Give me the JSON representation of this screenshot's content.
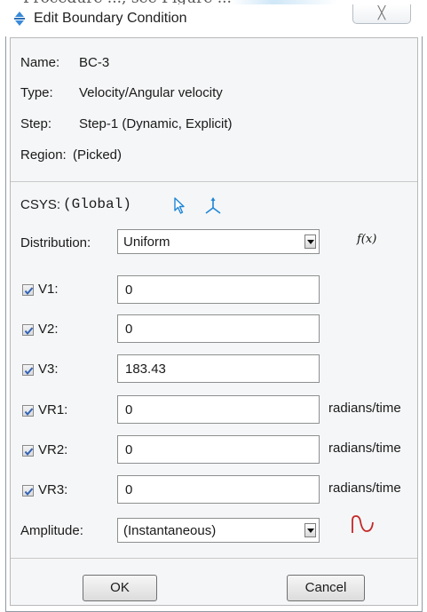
{
  "top_fragment": "Procedure ..., see Figure ...",
  "window": {
    "title": "Edit Boundary Condition",
    "close_glyph": "╳"
  },
  "info": {
    "name_label": "Name:",
    "name_value": "BC-3",
    "type_label": "Type:",
    "type_value": "Velocity/Angular velocity",
    "step_label": "Step:",
    "step_value": "Step-1 (Dynamic, Explicit)",
    "region_label": "Region:",
    "region_value": "(Picked)"
  },
  "csys": {
    "label": "CSYS:",
    "value": "(Global)",
    "icons": [
      "select-arrow-icon",
      "axis-triad-icon"
    ]
  },
  "distribution": {
    "label": "Distribution:",
    "selected": "Uniform",
    "fx_label": "f(x)"
  },
  "components": [
    {
      "label": "V1:",
      "checked": true,
      "value": "0",
      "unit": ""
    },
    {
      "label": "V2:",
      "checked": true,
      "value": "0",
      "unit": ""
    },
    {
      "label": "V3:",
      "checked": true,
      "value": "183.43",
      "unit": ""
    },
    {
      "label": "VR1:",
      "checked": true,
      "value": "0",
      "unit": "radians/time"
    },
    {
      "label": "VR2:",
      "checked": true,
      "value": "0",
      "unit": "radians/time"
    },
    {
      "label": "VR3:",
      "checked": true,
      "value": "0",
      "unit": "radians/time"
    }
  ],
  "amplitude": {
    "label": "Amplitude:",
    "selected": "(Instantaneous)",
    "icon": "amplitude-curve-icon"
  },
  "buttons": {
    "ok": "OK",
    "cancel": "Cancel"
  },
  "colors": {
    "icon_blue": "#1f86d6",
    "icon_red": "#c42828",
    "check_blue": "#2f62b8"
  }
}
